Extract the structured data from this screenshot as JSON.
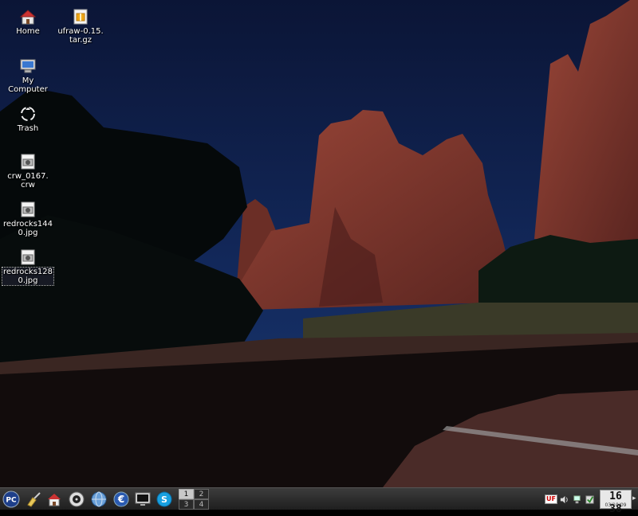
{
  "desktop": {
    "icons": [
      {
        "label": "Home",
        "icon": "home-folder-icon"
      },
      {
        "label": "ufraw-0.15.\ntar.gz",
        "icon": "archive-file-icon"
      },
      {
        "label": "My\nComputer",
        "icon": "computer-icon"
      },
      {
        "label": "Trash",
        "icon": "trash-icon"
      },
      {
        "label": "crw_0167.\ncrw",
        "icon": "image-file-icon"
      },
      {
        "label": "redrocks144\n0.jpg",
        "icon": "image-file-icon"
      },
      {
        "label": "redrocks128\n0.jpg",
        "icon": "image-file-icon"
      }
    ]
  },
  "taskbar": {
    "launchers": [
      {
        "name": "start-menu-pc-icon"
      },
      {
        "name": "cleanup-broom-icon"
      },
      {
        "name": "home-folder-icon"
      },
      {
        "name": "media-player-icon"
      },
      {
        "name": "web-browser-globe-icon"
      },
      {
        "name": "euro-currency-icon"
      },
      {
        "name": "terminal-monitor-icon"
      },
      {
        "name": "skype-icon"
      }
    ],
    "pager": [
      "1",
      "2",
      "3",
      "4"
    ],
    "active_desktop": "1",
    "tray": {
      "keyboard_layout": "UF"
    },
    "clock": {
      "time": "16 38",
      "date": "03/10/09"
    }
  },
  "colors": {
    "taskbar_bg": "#2a2a2a",
    "sky": "#0e1a3d",
    "rock": "#8a3a2e"
  }
}
